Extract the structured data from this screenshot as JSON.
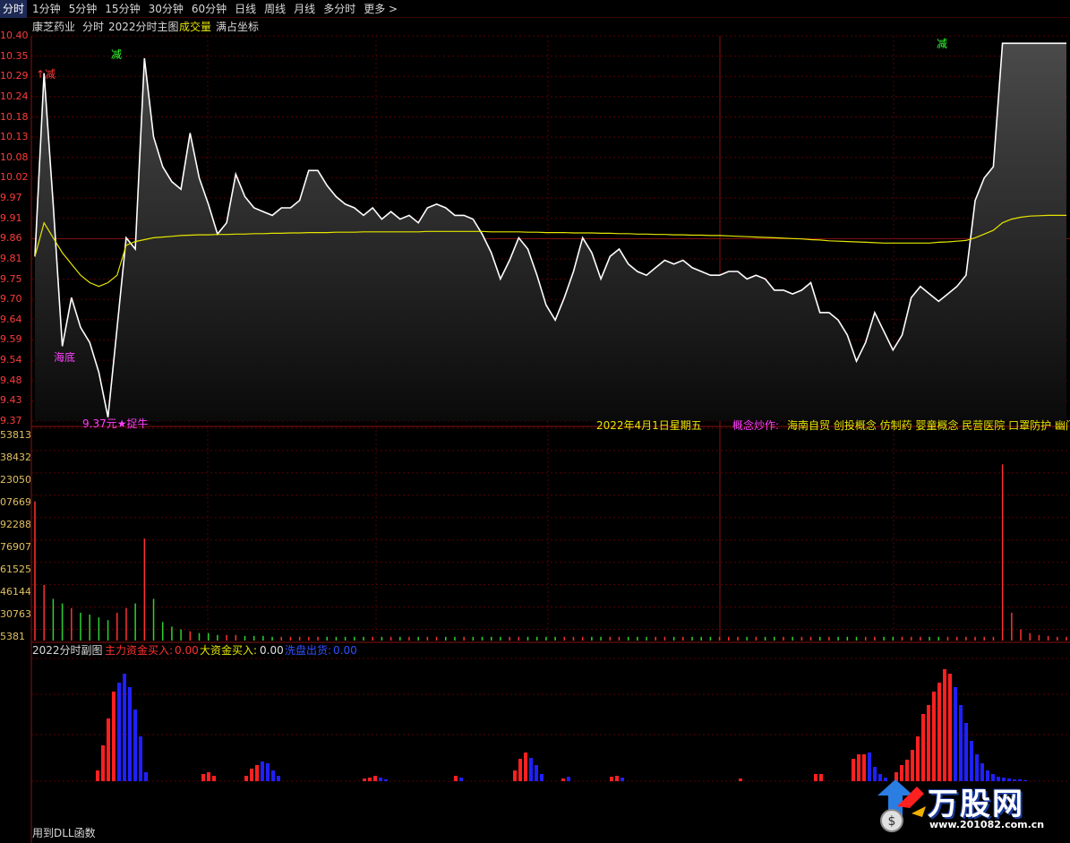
{
  "tabs": [
    {
      "label": "分时",
      "active": true
    },
    {
      "label": "1分钟"
    },
    {
      "label": "5分钟"
    },
    {
      "label": "15分钟"
    },
    {
      "label": "30分钟"
    },
    {
      "label": "60分钟"
    },
    {
      "label": "日线"
    },
    {
      "label": "周线"
    },
    {
      "label": "月线"
    },
    {
      "label": "多分时"
    },
    {
      "label": "更多 >"
    }
  ],
  "header": {
    "stock_name": "康芝药业",
    "mode": "分时",
    "indicator": "2022分时主图",
    "volume_label": "成交量",
    "coord_mode": "满占坐标"
  },
  "price_axis": [
    "10.40",
    "10.35",
    "10.29",
    "10.24",
    "10.18",
    "10.13",
    "10.08",
    "10.02",
    "9.97",
    "9.91",
    "9.86",
    "9.81",
    "9.75",
    "9.70",
    "9.64",
    "9.59",
    "9.54",
    "9.48",
    "9.43",
    "9.37"
  ],
  "volume_axis": [
    "53813",
    "38432",
    "23050",
    "07669",
    "92288",
    "76907",
    "61525",
    "46144",
    "30763",
    "5381"
  ],
  "annotations": {
    "high_label": "↑减",
    "peak1_label": "减",
    "peak2_label": "减",
    "low_signal": "海底",
    "low_price": "9.37元★捉牛"
  },
  "date_label": "2022年4月1日星期五",
  "concept": {
    "label": "概念炒作:",
    "text": "海南自贸 创投概念 仿制药 婴童概念 民营医院 口罩防护 幽门"
  },
  "sub_panel": {
    "title": "2022分时副图",
    "main_force_label": "主力资金买入:",
    "main_force_value": "0.00",
    "large_label": "大资金买入:",
    "large_value": "0.00",
    "wash_label": "洗盘出货:",
    "wash_value": "0.00"
  },
  "footer": "用到DLL函数",
  "logo": {
    "name": "万股网",
    "url_text": "www.201082.com.cn"
  },
  "colors": {
    "up": "#ff3b3b",
    "line": "#ffffff",
    "avg": "#e6e600",
    "grid": "#5a0000",
    "buy": "#ff2020",
    "sell": "#2020ff",
    "vol_up": "#ff3030",
    "vol_dn": "#30d030"
  },
  "chart_data": {
    "type": "line",
    "ylim": [
      9.37,
      10.4
    ],
    "price_series": [
      9.81,
      10.3,
      9.95,
      9.57,
      9.7,
      9.62,
      9.58,
      9.5,
      9.38,
      9.62,
      9.86,
      9.83,
      10.34,
      10.13,
      10.05,
      10.01,
      9.99,
      10.14,
      10.02,
      9.95,
      9.87,
      9.9,
      10.03,
      9.97,
      9.94,
      9.93,
      9.92,
      9.94,
      9.94,
      9.96,
      10.04,
      10.04,
      10.0,
      9.97,
      9.95,
      9.94,
      9.92,
      9.94,
      9.91,
      9.93,
      9.91,
      9.92,
      9.9,
      9.94,
      9.95,
      9.94,
      9.92,
      9.92,
      9.91,
      9.87,
      9.82,
      9.75,
      9.8,
      9.86,
      9.83,
      9.76,
      9.68,
      9.64,
      9.7,
      9.77,
      9.86,
      9.82,
      9.75,
      9.81,
      9.83,
      9.79,
      9.77,
      9.76,
      9.78,
      9.8,
      9.79,
      9.8,
      9.78,
      9.77,
      9.76,
      9.76,
      9.77,
      9.77,
      9.75,
      9.76,
      9.75,
      9.72,
      9.72,
      9.71,
      9.72,
      9.74,
      9.66,
      9.66,
      9.64,
      9.6,
      9.53,
      9.58,
      9.66,
      9.61,
      9.56,
      9.6,
      9.7,
      9.73,
      9.71,
      9.69,
      9.71,
      9.73,
      9.76,
      9.96,
      10.02,
      10.05,
      10.38,
      10.38,
      10.38,
      10.38,
      10.38,
      10.38,
      10.38,
      10.38
    ],
    "avg_series": [
      9.81,
      9.9,
      9.86,
      9.82,
      9.79,
      9.76,
      9.74,
      9.73,
      9.74,
      9.76,
      9.84,
      9.85,
      9.855,
      9.86,
      9.862,
      9.864,
      9.866,
      9.867,
      9.868,
      9.868,
      9.869,
      9.869,
      9.87,
      9.87,
      9.871,
      9.871,
      9.872,
      9.872,
      9.873,
      9.873,
      9.874,
      9.874,
      9.874,
      9.875,
      9.875,
      9.875,
      9.876,
      9.876,
      9.876,
      9.876,
      9.876,
      9.876,
      9.876,
      9.877,
      9.877,
      9.877,
      9.877,
      9.877,
      9.877,
      9.877,
      9.876,
      9.876,
      9.876,
      9.876,
      9.875,
      9.875,
      9.874,
      9.874,
      9.874,
      9.873,
      9.873,
      9.873,
      9.872,
      9.872,
      9.871,
      9.871,
      9.87,
      9.87,
      9.869,
      9.869,
      9.868,
      9.868,
      9.867,
      9.867,
      9.866,
      9.866,
      9.865,
      9.864,
      9.863,
      9.862,
      9.861,
      9.86,
      9.859,
      9.858,
      9.857,
      9.855,
      9.854,
      9.852,
      9.851,
      9.85,
      9.849,
      9.848,
      9.847,
      9.846,
      9.846,
      9.846,
      9.846,
      9.846,
      9.846,
      9.848,
      9.849,
      9.851,
      9.853,
      9.86,
      9.87,
      9.88,
      9.9,
      9.91,
      9.915,
      9.918,
      9.919,
      9.92,
      9.92,
      9.92
    ],
    "volume_series": [
      150,
      60,
      45,
      40,
      35,
      30,
      28,
      25,
      22,
      30,
      35,
      40,
      110,
      45,
      20,
      15,
      12,
      10,
      8,
      8,
      6,
      6,
      6,
      5,
      5,
      5,
      4,
      4,
      4,
      4,
      4,
      4,
      4,
      4,
      4,
      4,
      4,
      4,
      4,
      4,
      4,
      4,
      4,
      4,
      4,
      4,
      4,
      4,
      4,
      4,
      4,
      4,
      4,
      4,
      4,
      4,
      4,
      4,
      4,
      4,
      4,
      4,
      4,
      4,
      4,
      4,
      4,
      4,
      4,
      4,
      4,
      4,
      4,
      4,
      4,
      4,
      4,
      4,
      4,
      4,
      4,
      4,
      4,
      4,
      4,
      4,
      4,
      4,
      4,
      4,
      4,
      4,
      4,
      4,
      4,
      4,
      4,
      4,
      4,
      4,
      4,
      4,
      4,
      4,
      4,
      4,
      190,
      30,
      12,
      8,
      6,
      5,
      4,
      4,
      4,
      4
    ],
    "buy_bars": [
      [
        107,
        12
      ],
      [
        113,
        40
      ],
      [
        119,
        70
      ],
      [
        125,
        100
      ],
      [
        131,
        110
      ],
      [
        137,
        120
      ],
      [
        143,
        105
      ],
      [
        149,
        80
      ],
      [
        155,
        50
      ],
      [
        161,
        10
      ],
      [
        225,
        8
      ],
      [
        231,
        10
      ],
      [
        237,
        6
      ],
      [
        273,
        6
      ],
      [
        279,
        14
      ],
      [
        285,
        18
      ],
      [
        291,
        22
      ],
      [
        297,
        20
      ],
      [
        303,
        12
      ],
      [
        309,
        6
      ],
      [
        405,
        3
      ],
      [
        411,
        4
      ],
      [
        417,
        6
      ],
      [
        423,
        4
      ],
      [
        429,
        2
      ],
      [
        507,
        6
      ],
      [
        513,
        4
      ],
      [
        573,
        12
      ],
      [
        579,
        25
      ],
      [
        585,
        32
      ],
      [
        591,
        26
      ],
      [
        597,
        18
      ],
      [
        603,
        8
      ],
      [
        627,
        3
      ],
      [
        633,
        5
      ],
      [
        681,
        5
      ],
      [
        687,
        6
      ],
      [
        693,
        4
      ],
      [
        825,
        3
      ],
      [
        909,
        8
      ],
      [
        915,
        8
      ],
      [
        951,
        25
      ],
      [
        957,
        30
      ],
      [
        963,
        30
      ],
      [
        969,
        32
      ],
      [
        975,
        16
      ],
      [
        981,
        8
      ],
      [
        987,
        4
      ],
      [
        999,
        10
      ],
      [
        1005,
        18
      ],
      [
        1011,
        24
      ],
      [
        1017,
        35
      ],
      [
        1023,
        50
      ],
      [
        1029,
        75
      ],
      [
        1035,
        85
      ],
      [
        1041,
        100
      ],
      [
        1047,
        110
      ],
      [
        1053,
        125
      ],
      [
        1059,
        120
      ],
      [
        1065,
        105
      ],
      [
        1071,
        85
      ],
      [
        1077,
        65
      ],
      [
        1083,
        45
      ],
      [
        1089,
        30
      ],
      [
        1095,
        20
      ],
      [
        1101,
        12
      ],
      [
        1107,
        8
      ],
      [
        1113,
        5
      ],
      [
        1119,
        4
      ],
      [
        1125,
        3
      ],
      [
        1131,
        2
      ],
      [
        1137,
        2
      ],
      [
        1143,
        1
      ]
    ],
    "sell_start_index": {
      "a": 131,
      "b": 291,
      "c": 591,
      "d": 969,
      "e": 1065
    }
  }
}
